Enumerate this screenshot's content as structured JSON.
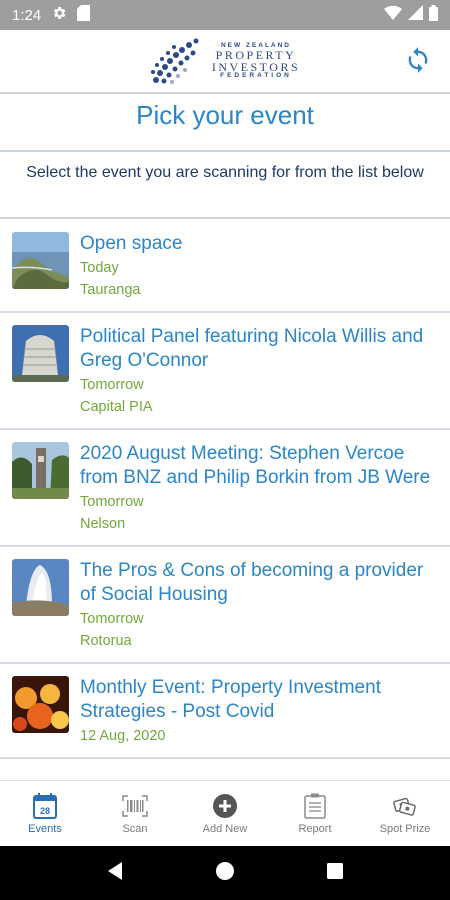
{
  "status_bar": {
    "time": "1:24"
  },
  "header": {
    "logo": {
      "line1": "NEW ZEALAND",
      "line2": "PROPERTY",
      "line3": "INVESTORS",
      "line4": "FEDERATION"
    }
  },
  "page_title": "Pick your event",
  "instruction": "Select the event you are scanning for from the list below",
  "events": [
    {
      "title": "Open space",
      "date": "Today",
      "location": "Tauranga",
      "thumb": "coast-aerial"
    },
    {
      "title": "Political Panel featuring Nicola Willis and Greg O'Connor",
      "date": "Tomorrow",
      "location": "Capital PIA",
      "thumb": "beehive"
    },
    {
      "title": "2020 August Meeting: Stephen Vercoe from BNZ and Philip Borkin from JB Were",
      "date": "Tomorrow",
      "location": "Nelson",
      "thumb": "clock-tower"
    },
    {
      "title": "The Pros & Cons of becoming a provider of Social Housing",
      "date": "Tomorrow",
      "location": "Rotorua",
      "thumb": "geyser"
    },
    {
      "title": "Monthly Event: Property Investment Strategies - Post Covid",
      "date": "12 Aug, 2020",
      "location": "",
      "thumb": "lanterns"
    }
  ],
  "nav": {
    "items": [
      {
        "label": "Events",
        "icon": "calendar-icon",
        "active": true,
        "badge": "28"
      },
      {
        "label": "Scan",
        "icon": "barcode-icon",
        "active": false
      },
      {
        "label": "Add New",
        "icon": "add-circle-icon",
        "active": false
      },
      {
        "label": "Report",
        "icon": "report-icon",
        "active": false
      },
      {
        "label": "Spot Prize",
        "icon": "tickets-icon",
        "active": false
      }
    ]
  },
  "colors": {
    "accent": "#2a86c8",
    "green": "#72a93a",
    "navy": "#1f3a66",
    "nav_active": "#2a6fb5"
  }
}
